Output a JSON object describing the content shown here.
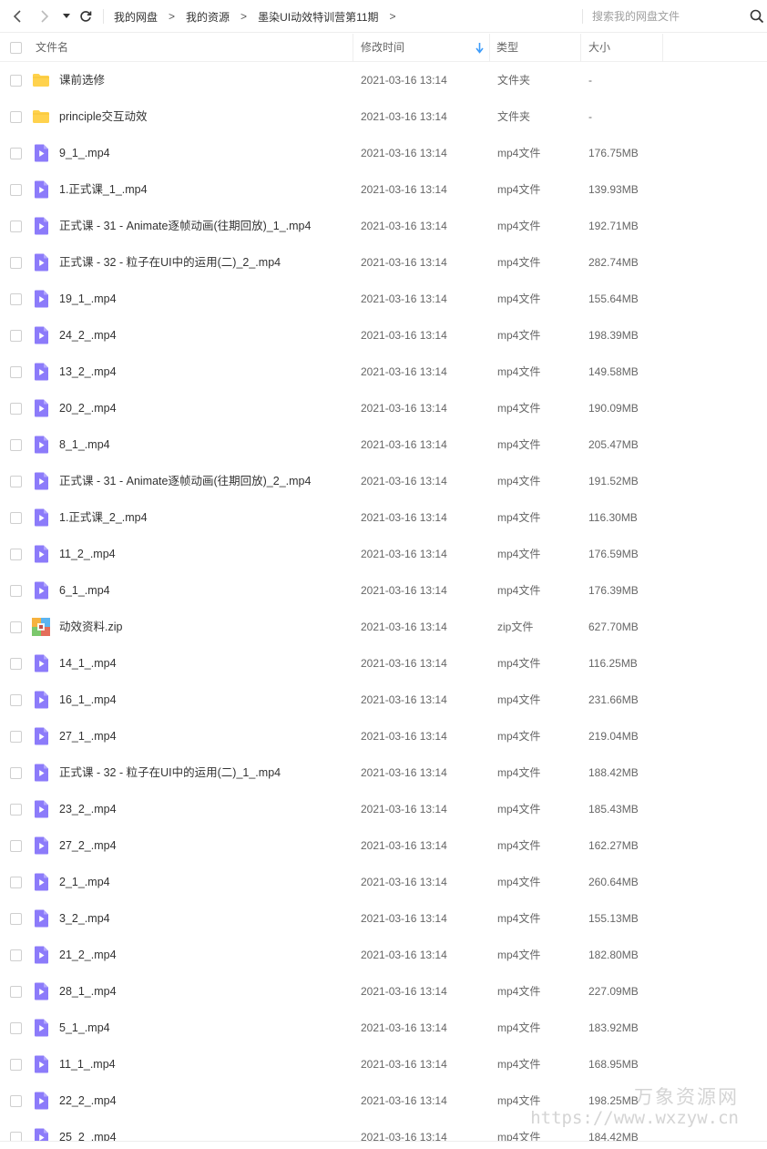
{
  "breadcrumb": [
    {
      "label": "我的网盘"
    },
    {
      "label": "我的资源"
    },
    {
      "label": "墨染UI动效特训营第11期"
    }
  ],
  "breadcrumb_separator": ">",
  "search": {
    "placeholder": "搜索我的网盘文件"
  },
  "columns": {
    "name": "文件名",
    "modified": "修改时间",
    "type": "类型",
    "size": "大小"
  },
  "sort": {
    "column": "modified",
    "direction": "descending"
  },
  "colors": {
    "folder": "#FFD24D",
    "video": "#8C7BFA",
    "zip": "#E46D5A",
    "sort_arrow": "#3C9BFA"
  },
  "files": [
    {
      "icon": "folder-icon",
      "name": "课前选修",
      "modified": "2021-03-16 13:14",
      "type": "文件夹",
      "size": "-"
    },
    {
      "icon": "folder-icon",
      "name": "principle交互动效",
      "modified": "2021-03-16 13:14",
      "type": "文件夹",
      "size": "-"
    },
    {
      "icon": "video-file-icon",
      "name": "9_1_.mp4",
      "modified": "2021-03-16 13:14",
      "type": "mp4文件",
      "size": "176.75MB"
    },
    {
      "icon": "video-file-icon",
      "name": "1.正式课_1_.mp4",
      "modified": "2021-03-16 13:14",
      "type": "mp4文件",
      "size": "139.93MB"
    },
    {
      "icon": "video-file-icon",
      "name": "正式课 - 31 - Animate逐帧动画(往期回放)_1_.mp4",
      "modified": "2021-03-16 13:14",
      "type": "mp4文件",
      "size": "192.71MB"
    },
    {
      "icon": "video-file-icon",
      "name": "正式课 - 32 - 粒子在UI中的运用(二)_2_.mp4",
      "modified": "2021-03-16 13:14",
      "type": "mp4文件",
      "size": "282.74MB"
    },
    {
      "icon": "video-file-icon",
      "name": "19_1_.mp4",
      "modified": "2021-03-16 13:14",
      "type": "mp4文件",
      "size": "155.64MB"
    },
    {
      "icon": "video-file-icon",
      "name": "24_2_.mp4",
      "modified": "2021-03-16 13:14",
      "type": "mp4文件",
      "size": "198.39MB"
    },
    {
      "icon": "video-file-icon",
      "name": "13_2_.mp4",
      "modified": "2021-03-16 13:14",
      "type": "mp4文件",
      "size": "149.58MB"
    },
    {
      "icon": "video-file-icon",
      "name": "20_2_.mp4",
      "modified": "2021-03-16 13:14",
      "type": "mp4文件",
      "size": "190.09MB"
    },
    {
      "icon": "video-file-icon",
      "name": "8_1_.mp4",
      "modified": "2021-03-16 13:14",
      "type": "mp4文件",
      "size": "205.47MB"
    },
    {
      "icon": "video-file-icon",
      "name": "正式课 - 31 - Animate逐帧动画(往期回放)_2_.mp4",
      "modified": "2021-03-16 13:14",
      "type": "mp4文件",
      "size": "191.52MB"
    },
    {
      "icon": "video-file-icon",
      "name": "1.正式课_2_.mp4",
      "modified": "2021-03-16 13:14",
      "type": "mp4文件",
      "size": "116.30MB"
    },
    {
      "icon": "video-file-icon",
      "name": "11_2_.mp4",
      "modified": "2021-03-16 13:14",
      "type": "mp4文件",
      "size": "176.59MB"
    },
    {
      "icon": "video-file-icon",
      "name": "6_1_.mp4",
      "modified": "2021-03-16 13:14",
      "type": "mp4文件",
      "size": "176.39MB"
    },
    {
      "icon": "zip-file-icon",
      "name": "动效资料.zip",
      "modified": "2021-03-16 13:14",
      "type": "zip文件",
      "size": "627.70MB"
    },
    {
      "icon": "video-file-icon",
      "name": "14_1_.mp4",
      "modified": "2021-03-16 13:14",
      "type": "mp4文件",
      "size": "116.25MB"
    },
    {
      "icon": "video-file-icon",
      "name": "16_1_.mp4",
      "modified": "2021-03-16 13:14",
      "type": "mp4文件",
      "size": "231.66MB"
    },
    {
      "icon": "video-file-icon",
      "name": "27_1_.mp4",
      "modified": "2021-03-16 13:14",
      "type": "mp4文件",
      "size": "219.04MB"
    },
    {
      "icon": "video-file-icon",
      "name": "正式课 - 32 - 粒子在UI中的运用(二)_1_.mp4",
      "modified": "2021-03-16 13:14",
      "type": "mp4文件",
      "size": "188.42MB"
    },
    {
      "icon": "video-file-icon",
      "name": "23_2_.mp4",
      "modified": "2021-03-16 13:14",
      "type": "mp4文件",
      "size": "185.43MB"
    },
    {
      "icon": "video-file-icon",
      "name": "27_2_.mp4",
      "modified": "2021-03-16 13:14",
      "type": "mp4文件",
      "size": "162.27MB"
    },
    {
      "icon": "video-file-icon",
      "name": "2_1_.mp4",
      "modified": "2021-03-16 13:14",
      "type": "mp4文件",
      "size": "260.64MB"
    },
    {
      "icon": "video-file-icon",
      "name": "3_2_.mp4",
      "modified": "2021-03-16 13:14",
      "type": "mp4文件",
      "size": "155.13MB"
    },
    {
      "icon": "video-file-icon",
      "name": "21_2_.mp4",
      "modified": "2021-03-16 13:14",
      "type": "mp4文件",
      "size": "182.80MB"
    },
    {
      "icon": "video-file-icon",
      "name": "28_1_.mp4",
      "modified": "2021-03-16 13:14",
      "type": "mp4文件",
      "size": "227.09MB"
    },
    {
      "icon": "video-file-icon",
      "name": "5_1_.mp4",
      "modified": "2021-03-16 13:14",
      "type": "mp4文件",
      "size": "183.92MB"
    },
    {
      "icon": "video-file-icon",
      "name": "11_1_.mp4",
      "modified": "2021-03-16 13:14",
      "type": "mp4文件",
      "size": "168.95MB"
    },
    {
      "icon": "video-file-icon",
      "name": "22_2_.mp4",
      "modified": "2021-03-16 13:14",
      "type": "mp4文件",
      "size": "198.25MB"
    },
    {
      "icon": "video-file-icon",
      "name": "25_2_.mp4",
      "modified": "2021-03-16 13:14",
      "type": "mp4文件",
      "size": "184.42MB"
    }
  ],
  "watermark": {
    "title": "万象资源网",
    "url": "https://www.wxzyw.cn"
  }
}
